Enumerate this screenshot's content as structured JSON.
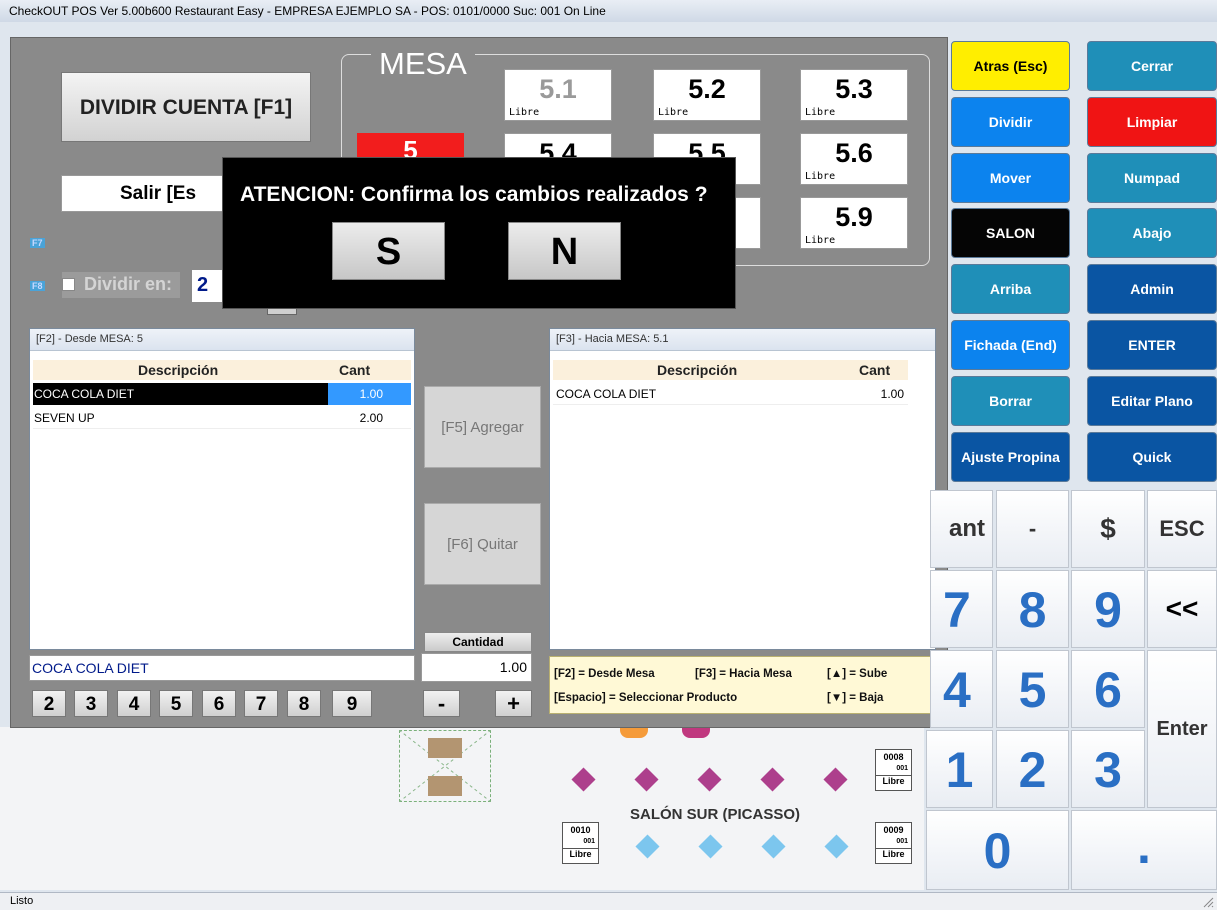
{
  "window": {
    "title": "CheckOUT POS Ver 5.00b600 Restaurant Easy - EMPRESA EJEMPLO SA - POS: 0101/0000 Suc: 001  On Line"
  },
  "status": {
    "text": "Listo"
  },
  "top": {
    "dividir_label": "DIVIDIR CUENTA  [F1]",
    "salir_label": "Salir    [Es",
    "mesa_title": "MESA",
    "current_table": "5",
    "f7_tag": "F7",
    "f8_tag": "F8",
    "dividir_en_label": "Dividir en:",
    "dividir_en_value": "2"
  },
  "tables": [
    {
      "num": "5.1",
      "status": "Libre"
    },
    {
      "num": "5.2",
      "status": "Libre"
    },
    {
      "num": "5.3",
      "status": "Libre"
    },
    {
      "num": "5.4",
      "status": ""
    },
    {
      "num": "5.5",
      "status": ""
    },
    {
      "num": "5.6",
      "status": "Libre"
    },
    {
      "num": "5.9",
      "status": "Libre"
    }
  ],
  "modal": {
    "message": "ATENCION: Confirma los cambios realizados ?",
    "yes_label": "S",
    "no_label": "N"
  },
  "from_panel": {
    "title": "[F2] - Desde MESA: 5",
    "col_desc": "Descripción",
    "col_cant": "Cant",
    "rows": [
      {
        "desc": "COCA COLA DIET",
        "cant": "1.00"
      },
      {
        "desc": "SEVEN UP",
        "cant": "2.00"
      }
    ],
    "selected_item": "COCA COLA DIET"
  },
  "to_panel": {
    "title": "[F3] - Hacia MESA: 5.1",
    "col_desc": "Descripción",
    "col_cant": "Cant",
    "rows": [
      {
        "desc": "COCA COLA DIET",
        "cant": "1.00"
      }
    ]
  },
  "actions": {
    "agregar": "[F5] Agregar",
    "quitar": "[F6] Quitar"
  },
  "cantidad": {
    "label": "Cantidad",
    "value": "1.00",
    "minus": "-",
    "plus": "+"
  },
  "quick_numbers": [
    "2",
    "3",
    "4",
    "5",
    "6",
    "7",
    "8",
    "9"
  ],
  "legend": {
    "l1": "[F2] = Desde Mesa",
    "l2": "[F3] = Hacia Mesa",
    "l3": "[▲] = Sube",
    "l4": "[Espacio] = Seleccionar Producto",
    "l5": "[▼] = Baja"
  },
  "function_buttons": [
    {
      "label": "Atras (Esc)",
      "color": "#ffee00",
      "text": "#000000"
    },
    {
      "label": "Cerrar",
      "color": "#1f8fb8",
      "text": "#ffffff"
    },
    {
      "label": "Dividir",
      "color": "#0c83ee",
      "text": "#ffffff"
    },
    {
      "label": "Limpiar",
      "color": "#f01414",
      "text": "#ffffff"
    },
    {
      "label": "Mover",
      "color": "#0c83ee",
      "text": "#ffffff"
    },
    {
      "label": "Numpad",
      "color": "#1f8fb8",
      "text": "#ffffff"
    },
    {
      "label": "SALON",
      "color": "#050505",
      "text": "#ffffff"
    },
    {
      "label": "Abajo",
      "color": "#1f8fb8",
      "text": "#ffffff"
    },
    {
      "label": "Arriba",
      "color": "#1f8fb8",
      "text": "#ffffff"
    },
    {
      "label": "Admin",
      "color": "#0a55a3",
      "text": "#ffffff"
    },
    {
      "label": "Fichada (End)",
      "color": "#0c83ee",
      "text": "#ffffff"
    },
    {
      "label": "ENTER",
      "color": "#0a55a3",
      "text": "#ffffff"
    },
    {
      "label": "Borrar",
      "color": "#1f8fb8",
      "text": "#ffffff"
    },
    {
      "label": "Editar Plano",
      "color": "#0a55a3",
      "text": "#ffffff"
    },
    {
      "label": "Ajuste Propina",
      "color": "#0a55a3",
      "text": "#ffffff"
    },
    {
      "label": "Quick",
      "color": "#0a55a3",
      "text": "#ffffff"
    }
  ],
  "keypad": {
    "cant_partial": "ant",
    "dash": "-",
    "dollar": "$",
    "esc": "ESC",
    "k7": "7",
    "k8": "8",
    "k9": "9",
    "back": "<<",
    "k4": "4",
    "k5": "5",
    "k6": "6",
    "enter": "Enter",
    "k1": "1",
    "k2": "2",
    "k3": "3",
    "k0": "0",
    "dot": "."
  },
  "floor": {
    "salon_name": "SALÓN SUR (PICASSO)",
    "tags": [
      {
        "num": "0008",
        "suc": "001",
        "status": "Libre"
      },
      {
        "num": "0010",
        "suc": "001",
        "status": "Libre"
      },
      {
        "num": "0009",
        "suc": "001",
        "status": "Libre"
      }
    ]
  }
}
